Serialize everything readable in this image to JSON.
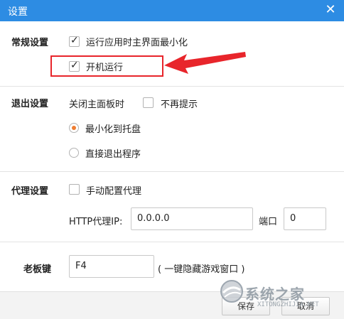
{
  "window": {
    "title": "设置",
    "close_glyph": "✕"
  },
  "general": {
    "label": "常规设置",
    "minimize_on_start": {
      "label": "运行应用时主界面最小化",
      "checked": true
    },
    "run_at_startup": {
      "label": "开机运行",
      "checked": true
    }
  },
  "exit": {
    "label": "退出设置",
    "close_panel_label": "关闭主面板时",
    "no_prompt": {
      "label": "不再提示",
      "checked": false
    },
    "options": [
      {
        "label": "最小化到托盘",
        "selected": true
      },
      {
        "label": "直接退出程序",
        "selected": false
      }
    ]
  },
  "proxy": {
    "label": "代理设置",
    "manual": {
      "label": "手动配置代理",
      "checked": false
    },
    "ip_label": "HTTP代理IP:",
    "ip_value": "0.0.0.0",
    "port_label": "端口",
    "port_value": "0"
  },
  "boss_key": {
    "label": "老板键",
    "value": "F4",
    "hint": "( 一键隐藏游戏窗口 )"
  },
  "footer": {
    "save_label": "保存",
    "cancel_label": "取消"
  },
  "annotation": {
    "color": "#e8252b"
  },
  "colors": {
    "titlebar": "#2d8ce3",
    "radio_selected": "#ef7d31"
  },
  "watermark": {
    "text": "系统之家",
    "url": "XITONGZHIJIA.NET"
  }
}
